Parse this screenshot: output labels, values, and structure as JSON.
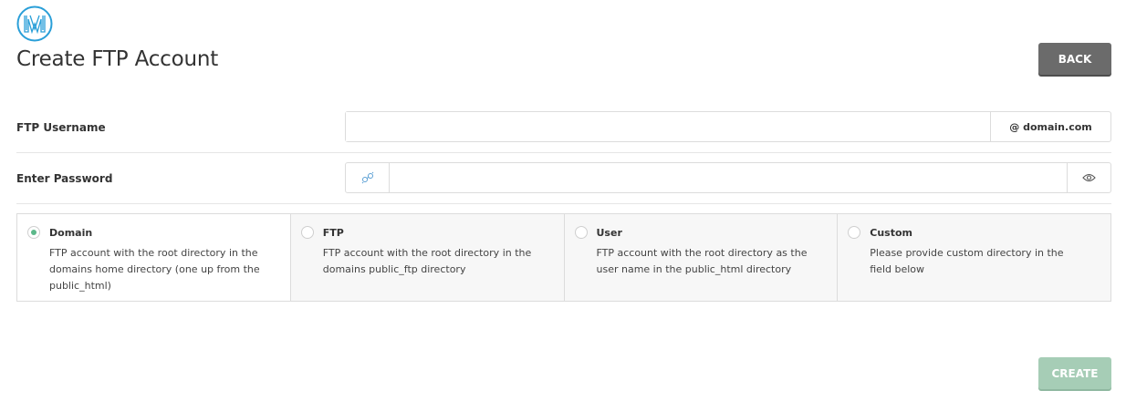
{
  "header": {
    "logo_icon": "brand-logo-icon",
    "title": "Create FTP Account",
    "back_label": "BACK"
  },
  "form": {
    "username": {
      "label": "FTP Username",
      "value": "",
      "placeholder": "",
      "suffix": "@ domain.com"
    },
    "password": {
      "label": "Enter Password",
      "value": "",
      "placeholder": "",
      "generate_icon": "key-generate-icon",
      "toggle_icon": "eye-icon"
    }
  },
  "directory_options": [
    {
      "title": "Domain",
      "desc": "FTP account with the root directory in the domains home directory (one up from the public_html)",
      "selected": true
    },
    {
      "title": "FTP",
      "desc": "FTP account with the root directory in the domains public_ftp directory",
      "selected": false
    },
    {
      "title": "User",
      "desc": "FTP account with the root directory as the user name in the public_html directory",
      "selected": false
    },
    {
      "title": "Custom",
      "desc": "Please provide custom directory in the field below",
      "selected": false
    }
  ],
  "footer": {
    "create_label": "CREATE"
  },
  "colors": {
    "accent": "#5cb88a",
    "brand": "#2a9fd8",
    "back_button": "#6b6b6b",
    "create_button_disabled": "#a6cdb6"
  }
}
